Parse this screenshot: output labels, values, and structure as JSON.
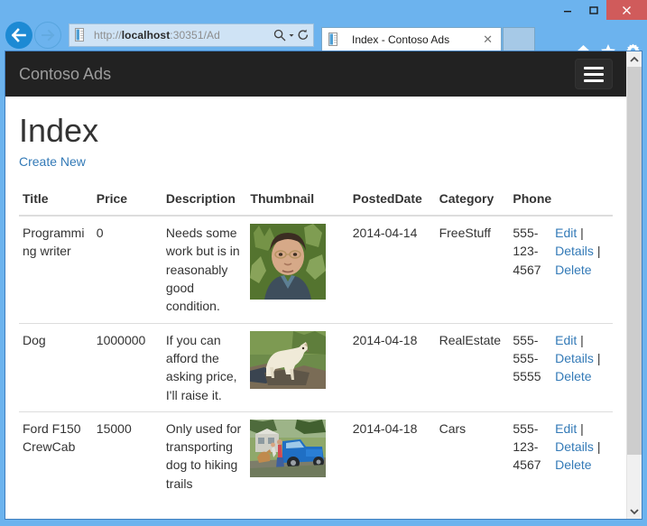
{
  "browser": {
    "window_controls": {
      "minimize_label": "Minimize",
      "maximize_label": "Maximize",
      "close_label": "Close"
    },
    "back_label": "Back",
    "forward_label": "Forward",
    "address": {
      "url_prefix": "http://",
      "url_host": "localhost",
      "url_suffix": ":30351/Ad",
      "search_icon": "search-icon",
      "dropdown_icon": "chevron-down-icon",
      "refresh_icon": "refresh-icon"
    },
    "tabs": [
      {
        "title": "Index - Contoso Ads",
        "close_label": "✕",
        "active": true
      }
    ],
    "new_tab_label": "New tab",
    "toolbar_icons": [
      {
        "name": "home-icon",
        "label": "Home"
      },
      {
        "name": "favorites-star-icon",
        "label": "Favorites"
      },
      {
        "name": "tools-gear-icon",
        "label": "Tools"
      }
    ]
  },
  "page": {
    "navbar": {
      "brand": "Contoso Ads",
      "toggle_label": "Toggle navigation"
    },
    "title": "Index",
    "create_new_label": "Create New",
    "table": {
      "headers": [
        "Title",
        "Price",
        "Description",
        "Thumbnail",
        "PostedDate",
        "Category",
        "Phone",
        ""
      ],
      "rows": [
        {
          "title": "Programming writer",
          "price": "0",
          "description": "Needs some work but is in reasonably good condition.",
          "thumbnail": "portrait-man-photo",
          "posted_date": "2014-04-14",
          "category": "FreeStuff",
          "phone": "555-123-4567",
          "actions": [
            "Edit",
            "Details",
            "Delete"
          ]
        },
        {
          "title": "Dog",
          "price": "1000000",
          "description": "If you can afford the asking price, I'll raise it.",
          "thumbnail": "white-dog-photo",
          "posted_date": "2014-04-18",
          "category": "RealEstate",
          "phone": "555-555-5555",
          "actions": [
            "Edit",
            "Details",
            "Delete"
          ]
        },
        {
          "title": "Ford F150 CrewCab",
          "price": "15000",
          "description": "Only used for transporting dog to hiking trails",
          "thumbnail": "blue-truck-photo",
          "posted_date": "2014-04-18",
          "category": "Cars",
          "phone": "555-123-4567",
          "actions": [
            "Edit",
            "Details",
            "Delete"
          ]
        }
      ],
      "action_separator": "|"
    },
    "scrollbar": {
      "up_arrow": "chevron-up-icon",
      "down_arrow": "chevron-down-icon"
    }
  },
  "colors": {
    "chrome_blue": "#6cb3ee",
    "navbar_dark": "#222222",
    "link_blue": "#337ab7",
    "close_red": "#d05b5b",
    "brand_gray": "#9d9d9d"
  }
}
